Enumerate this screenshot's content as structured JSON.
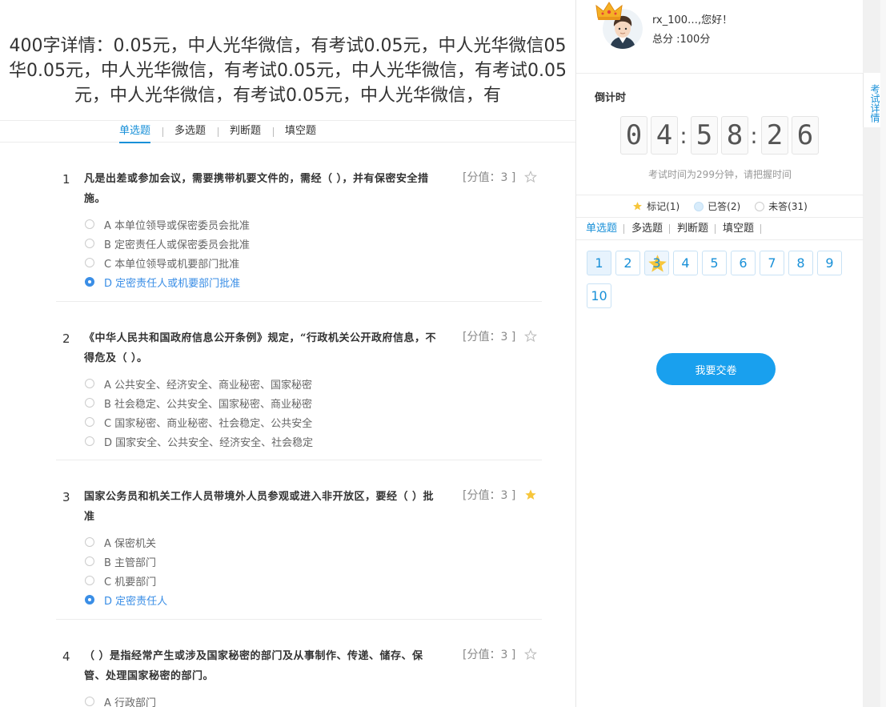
{
  "exam_title": "400字详情：0.05元，中人光华微信，有考试0.05元，中人光华微信05华0.05元，中人光华微信，有考试0.05元，中人光华微信，有考试0.05元，中人光华微信，有考试0.05元，中人光华微信，有",
  "type_tabs": [
    "单选题",
    "多选题",
    "判断题",
    "填空题"
  ],
  "questions": [
    {
      "num": "1",
      "stem": "凡是出差或参加会议，需要携带机要文件的，需经（  ），并有保密安全措施。",
      "score": "[分值：3 ]",
      "starred": false,
      "options": [
        {
          "text": "A 本单位领导或保密委员会批准",
          "selected": false
        },
        {
          "text": "B 定密责任人或保密委员会批准",
          "selected": false
        },
        {
          "text": "C 本单位领导或机要部门批准",
          "selected": false
        },
        {
          "text": "D 定密责任人或机要部门批准",
          "selected": true
        }
      ]
    },
    {
      "num": "2",
      "stem": "《中华人民共和国政府信息公开条例》规定，“行政机关公开政府信息，不得危及（  ）。",
      "score": "[分值：3 ]",
      "starred": false,
      "options": [
        {
          "text": "A 公共安全、经济安全、商业秘密、国家秘密",
          "selected": false
        },
        {
          "text": "B 社会稳定、公共安全、国家秘密、商业秘密",
          "selected": false
        },
        {
          "text": "C 国家秘密、商业秘密、社会稳定、公共安全",
          "selected": false
        },
        {
          "text": "D 国家安全、公共安全、经济安全、社会稳定",
          "selected": false
        }
      ]
    },
    {
      "num": "3",
      "stem": "国家公务员和机关工作人员带境外人员参观或进入非开放区，要经（  ）批准",
      "score": "[分值：3 ]",
      "starred": true,
      "options": [
        {
          "text": "A 保密机关",
          "selected": false
        },
        {
          "text": "B 主管部门",
          "selected": false
        },
        {
          "text": "C 机要部门",
          "selected": false
        },
        {
          "text": "D 定密责任人",
          "selected": true
        }
      ]
    },
    {
      "num": "4",
      "stem": "（  ）是指经常产生或涉及国家秘密的部门及从事制作、传递、储存、保管、处理国家秘密的部门。",
      "score": "[分值：3 ]",
      "starred": false,
      "options": [
        {
          "text": "A 行政部门",
          "selected": false
        }
      ]
    }
  ],
  "user": {
    "greeting": "rx_100…,您好！",
    "total_score": "总分 :100分"
  },
  "countdown": {
    "label": "倒计时",
    "digits": [
      "0",
      "4",
      "5",
      "8",
      "2",
      "6"
    ],
    "separator": ":",
    "note": "考试时间为299分钟，请把握时间"
  },
  "legend": {
    "flagged": "标记(1)",
    "answered": "已答(2)",
    "unanswered": "未答(31)"
  },
  "panel_tabs": [
    "单选题",
    "多选题",
    "判断题",
    "填空题"
  ],
  "question_buttons": [
    {
      "label": "1",
      "state": "answered"
    },
    {
      "label": "2",
      "state": "none"
    },
    {
      "label": "3",
      "state": "flag"
    },
    {
      "label": "4",
      "state": "none"
    },
    {
      "label": "5",
      "state": "none"
    },
    {
      "label": "6",
      "state": "none"
    },
    {
      "label": "7",
      "state": "none"
    },
    {
      "label": "8",
      "state": "none"
    },
    {
      "label": "9",
      "state": "none"
    },
    {
      "label": "10",
      "state": "none"
    }
  ],
  "submit_label": "我要交卷",
  "side_tab_label": "考试详情",
  "colors": {
    "accent": "#1890d8",
    "selected_option": "#3a8ee6",
    "submit": "#19a0ee",
    "star": "#f7c63b"
  }
}
